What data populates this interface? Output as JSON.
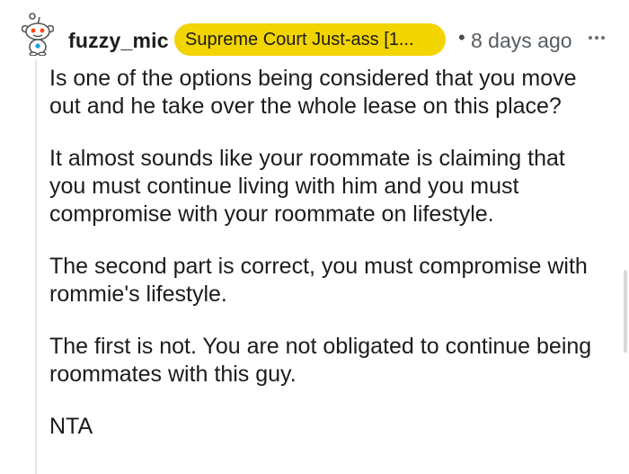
{
  "comment": {
    "username": "fuzzy_mic",
    "flair": "Supreme Court Just-ass [1...",
    "separator": "•",
    "timestamp": "8 days ago",
    "paragraphs": [
      "Is one of the options being considered that you move out and he take over the whole lease on this place?",
      "It almost sounds like your roommate is claiming that you must continue living with him and you must compromise with your roommate on lifestyle.",
      "The second part is correct, you must compromise with rommie's lifestyle.",
      "The first is not. You are not obligated to continue being roommates with this guy.",
      "NTA"
    ]
  },
  "colors": {
    "flair_background": "#f2d400",
    "username": "#1c1c1c",
    "timestamp": "#555c62",
    "thread_line": "#e3e5e8"
  },
  "icons": {
    "avatar": "snoo-avatar-icon",
    "more": "more-options-icon"
  }
}
